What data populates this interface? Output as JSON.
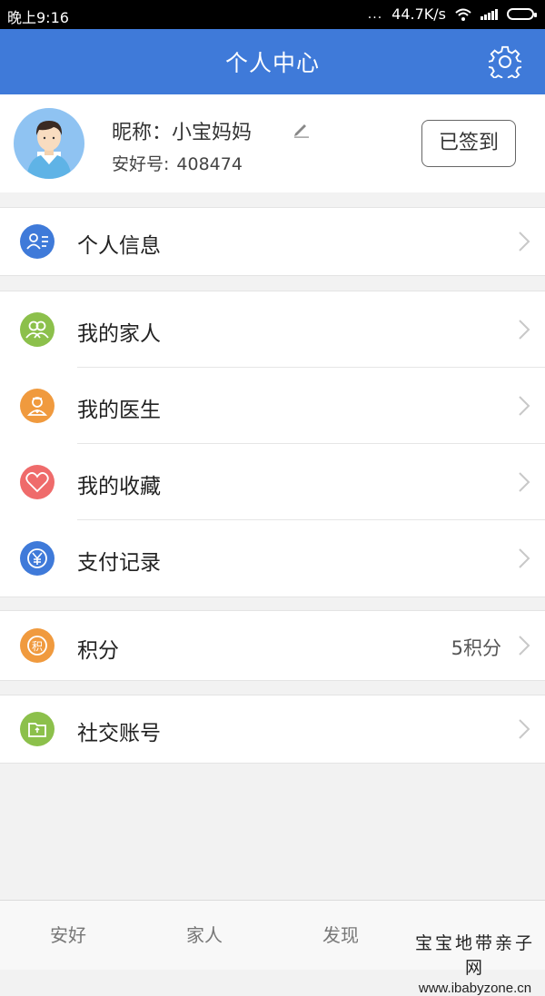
{
  "status_bar": {
    "time": "晚上9:16",
    "dots": "...",
    "speed": "44.7K/s"
  },
  "header": {
    "title": "个人中心",
    "settings_icon": "gear-icon"
  },
  "profile": {
    "nickname": "昵称：小宝妈妈",
    "account_label": "安好号:",
    "account_number": "408474",
    "signin_button": "已签到"
  },
  "menu": {
    "personal_info": {
      "label": "个人信息",
      "icon": "id-card-icon",
      "color": "#3f7ad9"
    },
    "family": {
      "label": "我的家人",
      "icon": "people-icon",
      "color": "#8cc04b"
    },
    "doctor": {
      "label": "我的医生",
      "icon": "doctor-icon",
      "color": "#f09a3e"
    },
    "favorites": {
      "label": "我的收藏",
      "icon": "heart-icon",
      "color": "#ef6b6b"
    },
    "payments": {
      "label": "支付记录",
      "icon": "yen-icon",
      "color": "#3f7ad9"
    },
    "points": {
      "label": "积分",
      "icon": "points-icon",
      "color": "#f09a3e",
      "value": "5积分"
    },
    "social": {
      "label": "社交账号",
      "icon": "folder-icon",
      "color": "#8cc04b"
    }
  },
  "tabs": [
    "安好",
    "家人",
    "发现"
  ],
  "watermark": {
    "line1": "宝宝地带亲子网",
    "line2": "www.ibabyzone.cn"
  }
}
